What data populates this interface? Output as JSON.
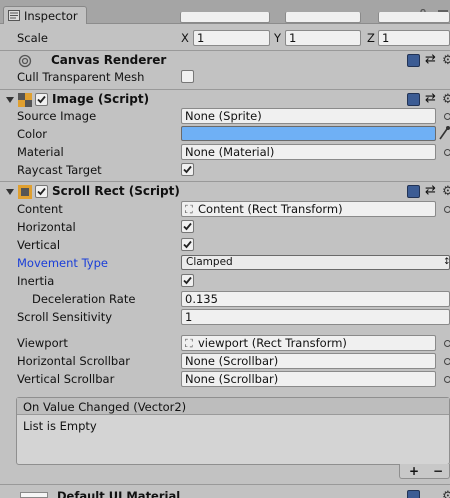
{
  "tab": {
    "label": "Inspector",
    "icon": "inspector-icon"
  },
  "transform_scale": {
    "label": "Scale",
    "x_label": "X",
    "x_value": "1",
    "y_label": "Y",
    "y_value": "1",
    "z_label": "Z",
    "z_value": "1"
  },
  "canvas_renderer": {
    "title": "Canvas Renderer",
    "cull_label": "Cull Transparent Mesh",
    "cull_checked": false
  },
  "image": {
    "title": "Image (Script)",
    "enabled": true,
    "source_image_label": "Source Image",
    "source_image_value": "None (Sprite)",
    "color_label": "Color",
    "color_value": "#6fb0f5",
    "material_label": "Material",
    "material_value": "None (Material)",
    "raycast_label": "Raycast Target",
    "raycast_checked": true
  },
  "scroll_rect": {
    "title": "Scroll Rect (Script)",
    "enabled": true,
    "content_label": "Content",
    "content_value": "Content (Rect Transform)",
    "horizontal_label": "Horizontal",
    "horizontal_checked": true,
    "vertical_label": "Vertical",
    "vertical_checked": true,
    "movement_type_label": "Movement Type",
    "movement_type_value": "Clamped",
    "inertia_label": "Inertia",
    "inertia_checked": true,
    "deceleration_label": "Deceleration Rate",
    "deceleration_value": "0.135",
    "sensitivity_label": "Scroll Sensitivity",
    "sensitivity_value": "1",
    "viewport_label": "Viewport",
    "viewport_value": "viewport (Rect Transform)",
    "h_scrollbar_label": "Horizontal Scrollbar",
    "h_scrollbar_value": "None (Scrollbar)",
    "v_scrollbar_label": "Vertical Scrollbar",
    "v_scrollbar_value": "None (Scrollbar)",
    "event_title": "On Value Changed (Vector2)",
    "event_empty": "List is Empty",
    "add_label": "+",
    "remove_label": "−"
  },
  "footer_item": {
    "label": "Default UI Material"
  },
  "colors": {
    "accent_blue": "#1a3ed8",
    "panel_bg": "#c2c2c2",
    "color_swatch": "#6fb0f5"
  }
}
